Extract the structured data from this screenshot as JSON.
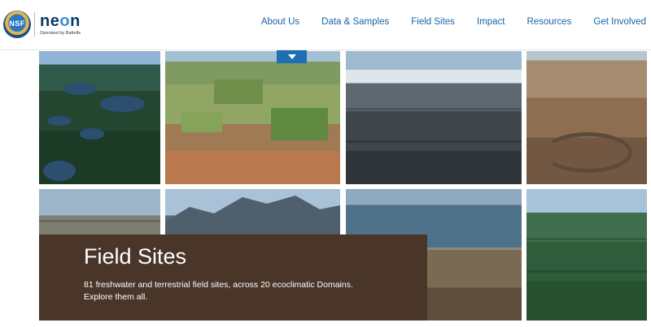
{
  "header": {
    "logo": {
      "seal_text": "NSF",
      "wordmark_n": "ne",
      "wordmark_o": "o",
      "wordmark_end": "n",
      "tagline": "Operated by Battelle"
    },
    "nav": [
      {
        "label": "About Us"
      },
      {
        "label": "Data & Samples"
      },
      {
        "label": "Field Sites"
      },
      {
        "label": "Impact"
      },
      {
        "label": "Resources"
      },
      {
        "label": "Get Involved"
      }
    ]
  },
  "hero": {
    "tiles": [
      {
        "name": "forest-lakes-photo",
        "icon": "photo"
      },
      {
        "name": "farmland-photo",
        "icon": "photo"
      },
      {
        "name": "snowy-mountains-photo",
        "icon": "photo"
      },
      {
        "name": "canyon-river-photo",
        "icon": "photo"
      },
      {
        "name": "desert-hills-photo",
        "icon": "photo"
      },
      {
        "name": "mountain-range-photo",
        "icon": "photo"
      },
      {
        "name": "lake-shore-photo",
        "icon": "photo"
      },
      {
        "name": "green-ridges-photo",
        "icon": "photo"
      }
    ],
    "scroll_tab_icon": "chevron-down-icon",
    "accent_color": "#1f6eb4"
  },
  "feature_card": {
    "title": "Field Sites",
    "description_line1": "81 freshwater and terrestrial field sites, across 20 ecoclimatic Domains.",
    "description_line2": "Explore them all.",
    "background_color": "#4a3529"
  }
}
